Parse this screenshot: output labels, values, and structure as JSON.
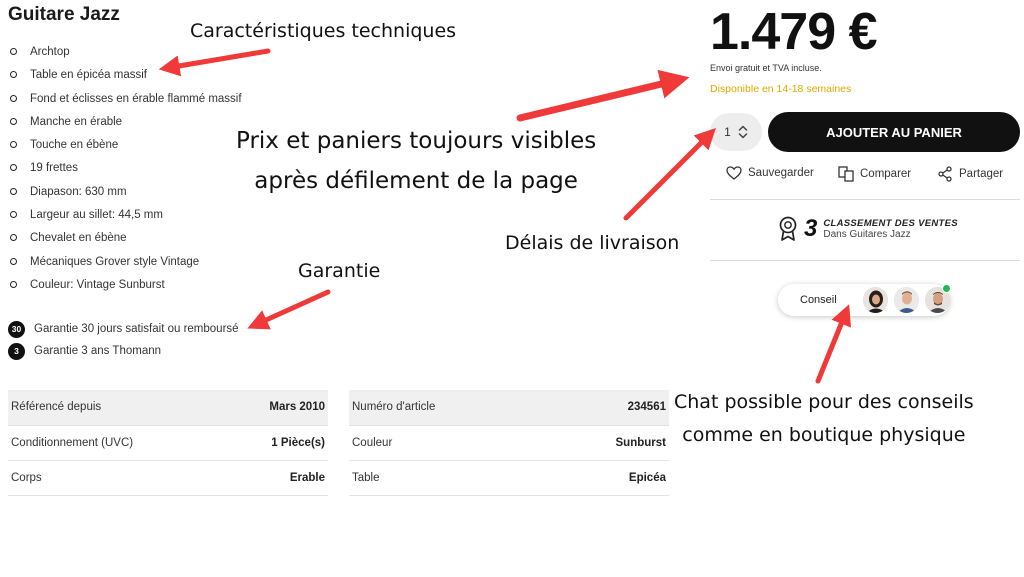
{
  "product": {
    "title": "Guitare Jazz"
  },
  "features": [
    "Archtop",
    "Table en épicéa massif",
    "Fond et éclisses en érable flammé massif",
    "Manche en érable",
    "Touche en ébène",
    "19 frettes",
    "Diapason: 630 mm",
    "Largeur au sillet: 44,5 mm",
    "Chevalet en ébène",
    "Mécaniques Grover style Vintage",
    "Couleur: Vintage Sunburst"
  ],
  "guarantees": [
    {
      "badge": "30",
      "label": "Garantie 30 jours satisfait ou remboursé"
    },
    {
      "badge": "3",
      "label": "Garantie 3 ans Thomann"
    }
  ],
  "specs_left": [
    {
      "label": "Référencé depuis",
      "value": "Mars 2010"
    },
    {
      "label": "Conditionnement (UVC)",
      "value": "1 Pièce(s)"
    },
    {
      "label": "Corps",
      "value": "Erable"
    }
  ],
  "specs_right": [
    {
      "label": "Numéro d'article",
      "value": "234561"
    },
    {
      "label": "Couleur",
      "value": "Sunburst"
    },
    {
      "label": "Table",
      "value": "Epicéa"
    }
  ],
  "purchase": {
    "price": "1.479 €",
    "price_note": "Envoi gratuit et TVA incluse.",
    "availability": "Disponible en 14-18 semaines",
    "quantity": "1",
    "add_to_cart": "AJOUTER AU PANIER",
    "save": "Sauvegarder",
    "compare": "Comparer",
    "share": "Partager"
  },
  "ranking": {
    "number": "3",
    "title": "CLASSEMENT DES VENTES",
    "subtitle": "Dans Guitares Jazz"
  },
  "chat": {
    "label": "Conseil"
  },
  "annotations": {
    "tech": "Caractéristiques techniques",
    "price_line1": "Prix et paniers toujours visibles",
    "price_line2": "après défilement de la page",
    "guarantee": "Garantie",
    "delivery": "Délais de livraison",
    "chat_line1": "Chat possible pour des conseils",
    "chat_line2": "comme en boutique physique"
  },
  "colors": {
    "availability": "#e0a800",
    "cart_button": "#111111",
    "annotation_arrow": "#f03a3a",
    "online_status": "#1db954"
  }
}
